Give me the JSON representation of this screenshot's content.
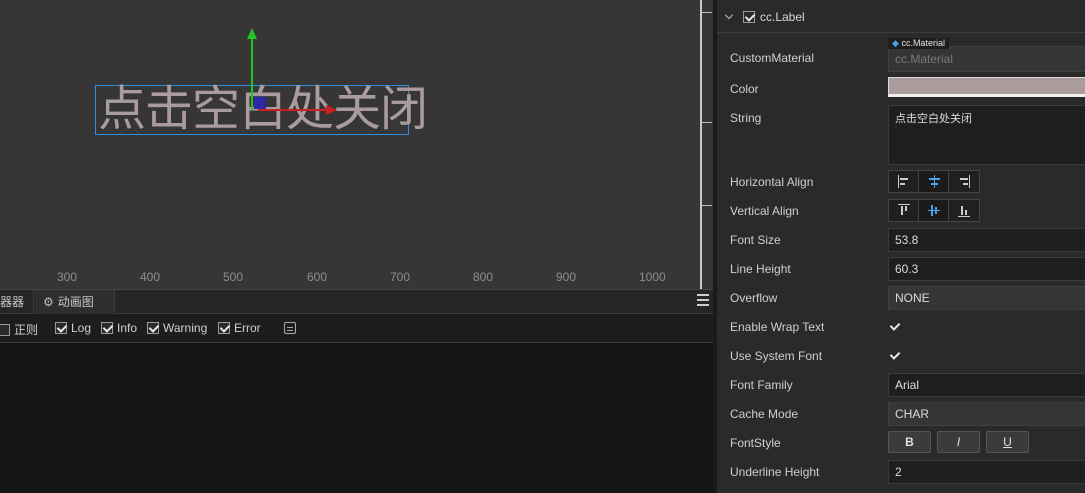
{
  "scene": {
    "label_text": "点击空白处关闭",
    "ruler_ticks": [
      "300",
      "400",
      "500",
      "600",
      "700",
      "800",
      "900",
      "1000"
    ],
    "colors": {
      "label_text": "#aa9c9c",
      "selection_border": "#2f8fe0",
      "gizmo_y": "#22c322",
      "gizmo_x": "#cc1f1f"
    }
  },
  "console": {
    "tabs": [
      {
        "label": "器器"
      },
      {
        "label": "动画图",
        "icon": "animation-icon"
      }
    ],
    "filters": [
      {
        "label": "正则",
        "checked": false
      },
      {
        "label": "Log",
        "checked": true
      },
      {
        "label": "Info",
        "checked": true
      },
      {
        "label": "Warning",
        "checked": true
      },
      {
        "label": "Error",
        "checked": true
      }
    ]
  },
  "inspector": {
    "component": {
      "title": "cc.Label",
      "enabled": true
    },
    "custom_material": {
      "label": "CustomMaterial",
      "tag": "cc.Material",
      "value": "cc.Material"
    },
    "color": {
      "label": "Color",
      "value": "#aa9c9c"
    },
    "string": {
      "label": "String",
      "value": "点击空白处关闭"
    },
    "horizontal_align": {
      "label": "Horizontal Align",
      "selected": "center"
    },
    "vertical_align": {
      "label": "Vertical Align",
      "selected": "center"
    },
    "font_size": {
      "label": "Font Size",
      "value": "53.8"
    },
    "line_height": {
      "label": "Line Height",
      "value": "60.3"
    },
    "overflow": {
      "label": "Overflow",
      "value": "NONE"
    },
    "enable_wrap_text": {
      "label": "Enable Wrap Text",
      "checked": true
    },
    "use_system_font": {
      "label": "Use System Font",
      "checked": true
    },
    "font_family": {
      "label": "Font Family",
      "value": "Arial"
    },
    "cache_mode": {
      "label": "Cache Mode",
      "value": "CHAR"
    },
    "font_style": {
      "label": "FontStyle",
      "bold": "B",
      "italic": "I",
      "underline": "U"
    },
    "underline_height": {
      "label": "Underline Height",
      "value": "2"
    }
  }
}
